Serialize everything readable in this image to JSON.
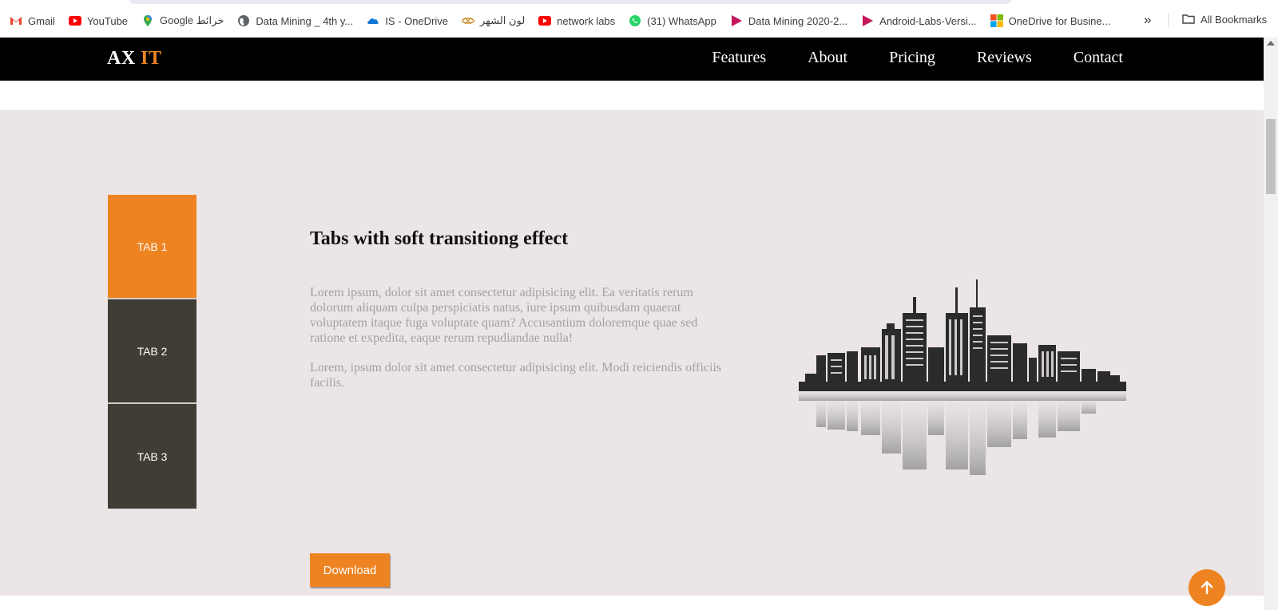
{
  "bookmarks": {
    "items": [
      {
        "label": "Gmail",
        "icon": "gmail-icon"
      },
      {
        "label": "YouTube",
        "icon": "youtube-icon"
      },
      {
        "label": "Google خرائط",
        "icon": "maps-pin-icon"
      },
      {
        "label": "Data Mining _ 4th y...",
        "icon": "globe-icon"
      },
      {
        "label": "IS - OneDrive",
        "icon": "cloud-icon"
      },
      {
        "label": "لون الشهر",
        "icon": "site-logo-icon"
      },
      {
        "label": "network labs",
        "icon": "youtube-icon"
      },
      {
        "label": "(31) WhatsApp",
        "icon": "whatsapp-icon"
      },
      {
        "label": "Data Mining 2020-2...",
        "icon": "play-icon"
      },
      {
        "label": "Android-Labs-Versi...",
        "icon": "play-icon"
      },
      {
        "label": "OneDrive for Busine...",
        "icon": "microsoft-icon"
      }
    ],
    "more": "»",
    "all_label": "All Bookmarks"
  },
  "nav": {
    "logo_main": "AX ",
    "logo_accent": "IT",
    "links": [
      "Features",
      "About",
      "Pricing",
      "Reviews",
      "Contact"
    ]
  },
  "tabs": {
    "items": [
      "TAB 1",
      "TAB 2",
      "TAB 3"
    ],
    "active_index": 0
  },
  "content": {
    "heading": "Tabs with soft transitiong effect",
    "paragraph1": "Lorem ipsum, dolor sit amet consectetur adipisicing elit. Ea veritatis rerum dolorum aliquam culpa perspiciatis natus, iure ipsum quibusdam quaerat voluptatem itaque fuga voluptate quam? Accusantium doloremque quae sed ratione et expedita, eaque rerum repudiandae nulla!",
    "paragraph2": "Lorem, ipsum dolor sit amet consectetur adipisicing elit. Modi reiciendis officiis facilis.",
    "button": "Download"
  },
  "colors": {
    "accent": "#ee8321",
    "nav_bg": "#000000",
    "tab_inactive": "#403d35",
    "section_bg": "#ebe5e5"
  }
}
